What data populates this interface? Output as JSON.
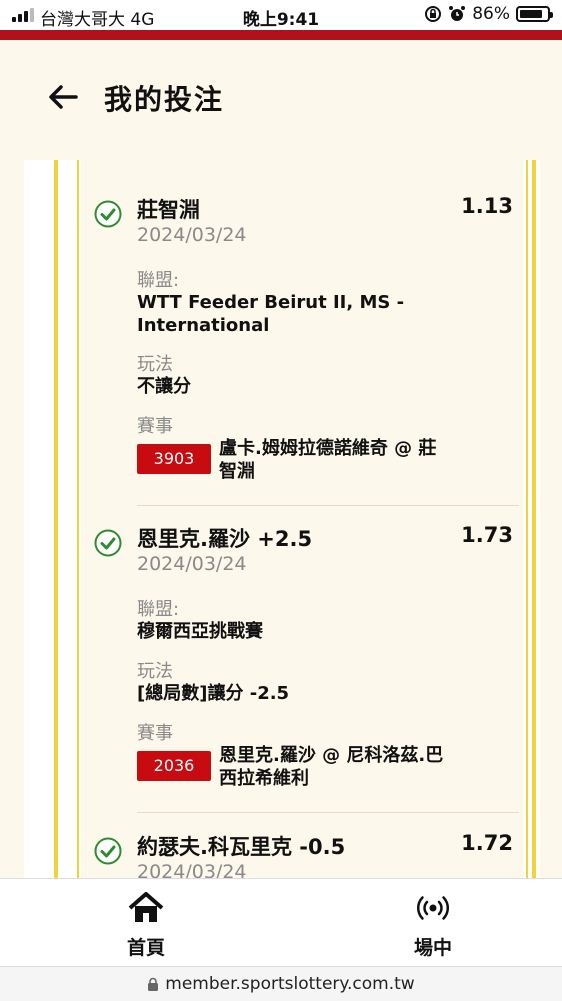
{
  "status_bar": {
    "carrier": "台灣大哥大  4G",
    "time": "晚上9:41",
    "battery": "86%",
    "battery_level": 0.86
  },
  "header": {
    "back_icon": "arrow-left-icon",
    "title": "我的投注"
  },
  "bets": [
    {
      "name": "莊智淵",
      "odds": "1.13",
      "date": "2024/03/24",
      "league_label": "聯盟:",
      "league": "WTT Feeder Beirut II, MS - International",
      "play_label": "玩法",
      "play": "不讓分",
      "event_label": "賽事",
      "event_id": "3903",
      "event": "盧卡.姆姆拉德諾維奇 @ 莊智淵",
      "status_icon": "check-circle-icon"
    },
    {
      "name": "恩里克.羅沙 +2.5",
      "odds": "1.73",
      "date": "2024/03/24",
      "league_label": "聯盟:",
      "league": "穆爾西亞挑戰賽",
      "play_label": "玩法",
      "play": "[總局數]讓分 -2.5",
      "event_label": "賽事",
      "event_id": "2036",
      "event": "恩里克.羅沙 @ 尼科洛茲.巴西拉希維利",
      "status_icon": "check-circle-icon"
    },
    {
      "name": "約瑟夫.科瓦里克 -0.5",
      "odds": "1.72",
      "date": "2024/03/24",
      "status_icon": "check-circle-icon"
    }
  ],
  "nav": {
    "home_label": "首頁",
    "home_icon": "home-icon",
    "live_label": "場中",
    "live_icon": "broadcast-icon"
  },
  "url": "member.sportslottery.com.tw",
  "colors": {
    "accent_red": "#b3111a",
    "badge_red": "#c70b10",
    "rail_yellow": "#f0d23c",
    "check_green": "#2e8b2e"
  }
}
